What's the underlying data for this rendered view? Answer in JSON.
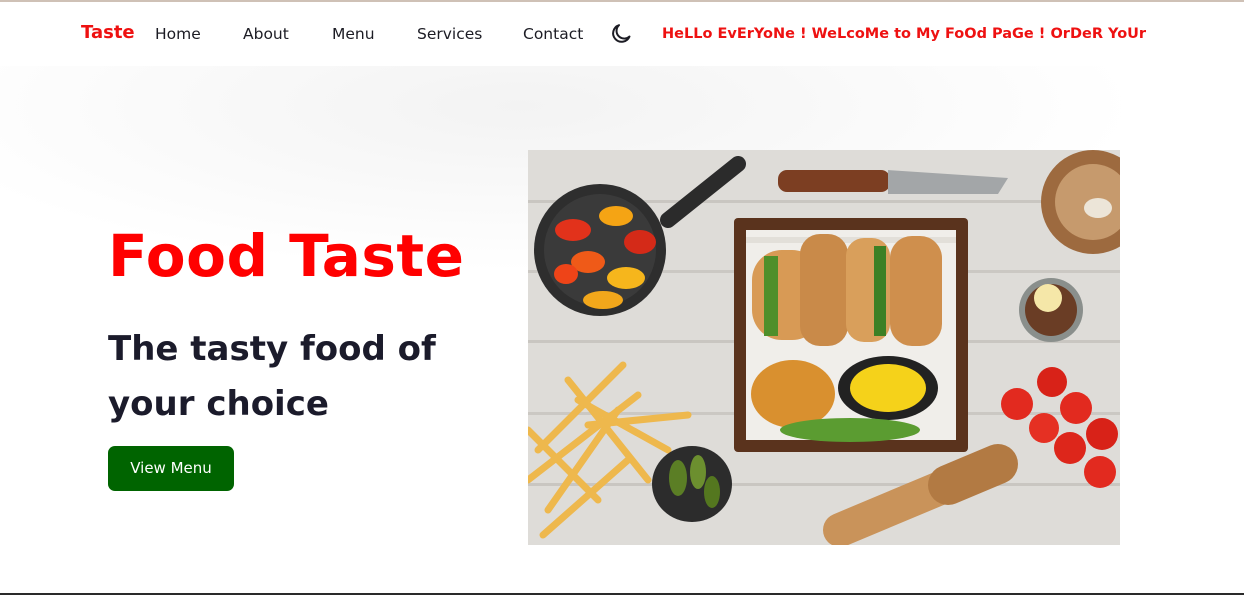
{
  "nav": {
    "brand": "Taste",
    "links": [
      "Home",
      "About",
      "Menu",
      "Services",
      "Contact"
    ],
    "theme_icon": "moon-icon",
    "marquee": "HeLLo EvErYoNe ! WeLcoMe to My FoOd PaGe ! OrDeR YoUr Be"
  },
  "hero": {
    "title": "Food Taste",
    "subtitle": "The tasty food of your choice",
    "button": "View Menu"
  },
  "colors": {
    "brand": "#ee1111",
    "title": "#ff0000",
    "button": "#006400",
    "text": "#1b1b2b"
  }
}
